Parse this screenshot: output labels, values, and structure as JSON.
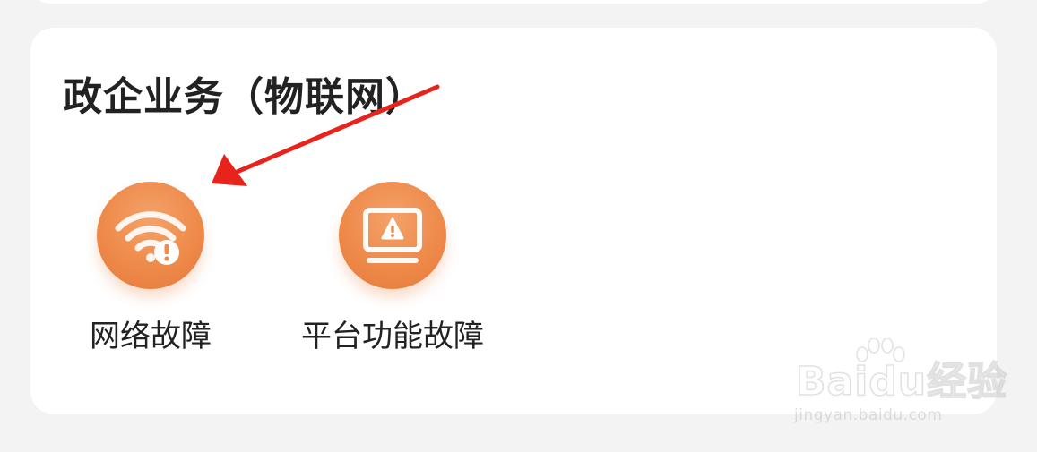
{
  "section": {
    "title": "政企业务（物联网）"
  },
  "services": [
    {
      "label": "网络故障",
      "icon": "wifi-alert-icon"
    },
    {
      "label": "平台功能故障",
      "icon": "monitor-warning-icon"
    }
  ],
  "watermark": {
    "brand": "Baidu经验",
    "url": "jingyan.baidu.com"
  },
  "colors": {
    "accent": "#ee8a4a",
    "annotation_arrow": "#e8231b",
    "card": "#ffffff",
    "background": "#f3f3f3"
  }
}
